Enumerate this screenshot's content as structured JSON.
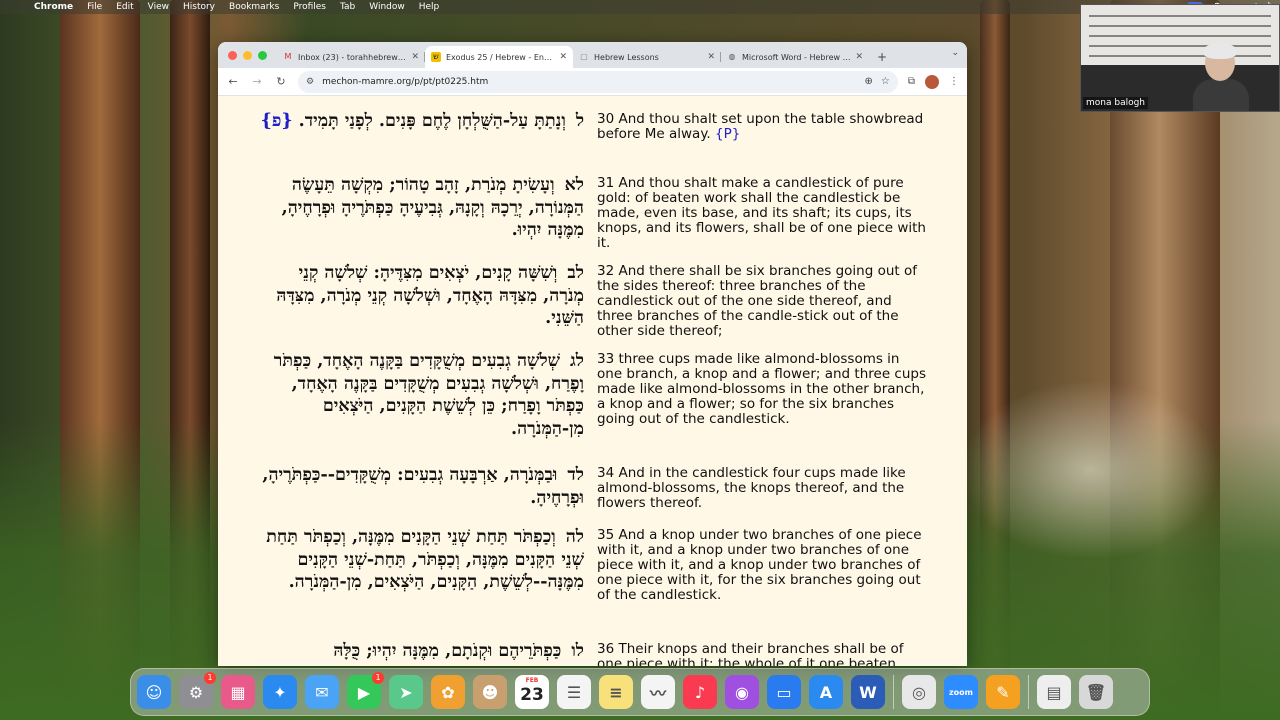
{
  "menubar": {
    "app_name": "Chrome",
    "items": [
      "File",
      "Edit",
      "View",
      "History",
      "Bookmarks",
      "Profiles",
      "Tab",
      "Window",
      "Help"
    ]
  },
  "zoom": {
    "participant_name": "mona balogh"
  },
  "browser": {
    "tabs": [
      {
        "title": "Inbox (23) - torahhebrewsch...",
        "icon": "gmail-icon",
        "active": false
      },
      {
        "title": "Exodus 25 / Hebrew - English",
        "icon": "mechon-mamre-icon",
        "active": true
      },
      {
        "title": "Hebrew Lessons",
        "icon": "doc-icon",
        "active": false
      },
      {
        "title": "Microsoft Word - Hebrew boo...",
        "icon": "globe-icon",
        "active": false
      }
    ],
    "new_tab_symbol": "+",
    "url": "mechon-mamre.org/p/pt/pt0225.htm"
  },
  "verses": [
    {
      "hebrew_num": "ל",
      "hebrew": "וְנָתַתָּ עַל-הַשֻּׁלְחָן לֶחֶם פָּנִים. לְפָנַי תָּמִיד.",
      "hebrew_p": "{פ}",
      "english": "30 And thou shalt set upon the table showbread before Me alway.",
      "english_p": "{P}"
    },
    {
      "hebrew_num": "לא",
      "hebrew": "וְעָשִׂיתָ מְנֹרַת, זָהָב טָהוֹר; מִקְשָׁה תֵּעָשֶׂה הַמְּנוֹרָה, יְרֵכָהּ וְקָנָהּ, גְּבִיעֶיהָ כַּפְתֹּרֶיהָ וּפְרָחֶיהָ, מִמֶּנָּה יִהְיוּ.",
      "english": "31 And thou shalt make a candlestick of pure gold: of beaten work shall the candlestick be made, even its base, and its shaft; its cups, its knops, and its flowers, shall be of one piece with it."
    },
    {
      "hebrew_num": "לב",
      "hebrew": "וְשִׁשָּׁה קָנִים, יֹצְאִים מִצִּדֶּיהָ: שְׁלֹשָׁה קְנֵי מְנֹרָה, מִצִּדָּהּ הָאֶחָד, וּשְׁלֹשָׁה קְנֵי מְנֹרָה, מִצִּדָּהּ הַשֵּׁנִי.",
      "english": "32 And there shall be six branches going out of the sides thereof: three branches of the candlestick out of the one side thereof, and three branches of the candle-stick out of the other side thereof;"
    },
    {
      "hebrew_num": "לג",
      "hebrew": "שְׁלֹשָׁה גְבִעִים מְשֻׁקָּדִים בַּקָּנֶה הָאֶחָד, כַּפְתֹּר וָפֶרַח, וּשְׁלֹשָׁה גְבִעִים מְשֻׁקָּדִים בַּקָּנֶה הָאֶחָד, כַּפְתֹּר וָפָרַח; כֵּן לְשֵׁשֶׁת הַקָּנִים, הַיֹּצְאִים מִן-הַמְּנֹרָה.",
      "english": "33 three cups made like almond-blossoms in one branch, a knop and a flower; and three cups made like almond-blossoms in the other branch, a knop and a flower; so for the six branches going out of the candlestick."
    },
    {
      "hebrew_num": "לד",
      "hebrew": "וּבַמְּנֹרָה, אַרְבָּעָה גְבִעִים: מְשֻׁקָּדִים--כַּפְתֹּרֶיהָ, וּפְרָחֶיהָ.",
      "english": "34 And in the candlestick four cups made like almond-blossoms, the knops thereof, and the flowers thereof."
    },
    {
      "hebrew_num": "לה",
      "hebrew": "וְכַפְתֹּר תַּחַת שְׁנֵי הַקָּנִים מִמֶּנָּה, וְכַפְתֹּר תַּחַת שְׁנֵי הַקָּנִים מִמֶּנָּה, וְכַפְתֹּר, תַּחַת-שְׁנֵי הַקָּנִים מִמֶּנָּה--לְשֵׁשֶׁת, הַקָּנִים, הַיֹּצְאִים, מִן-הַמְּנֹרָה.",
      "english": "35 And a knop under two branches of one piece with it, and a knop under two branches of one piece with it, and a knop under two branches of one piece with it, for the six branches going out of the candlestick."
    },
    {
      "hebrew_num": "לו",
      "hebrew": "כַּפְתֹּרֵיהֶם וּקְנֹתָם, מִמֶּנָּה יִהְיוּ; כֻּלָּהּ",
      "english": "36 Their knops and their branches shall be of one piece with it; the whole of it one beaten"
    }
  ],
  "dock": {
    "apps": [
      {
        "name": "finder-icon",
        "color": "#3a8ee8",
        "glyph": "☺"
      },
      {
        "name": "system-settings-icon",
        "color": "#8e8e93",
        "glyph": "⚙",
        "badge": "1"
      },
      {
        "name": "launchpad-icon",
        "color": "#e85a8a",
        "glyph": "▦"
      },
      {
        "name": "safari-icon",
        "color": "#2a8af0",
        "glyph": "✦"
      },
      {
        "name": "mail-icon",
        "color": "#4aa3f5",
        "glyph": "✉"
      },
      {
        "name": "facetime-icon",
        "color": "#34c759",
        "glyph": "▶",
        "badge": "1"
      },
      {
        "name": "maps-icon",
        "color": "#5ac88a",
        "glyph": "➤"
      },
      {
        "name": "photos-icon",
        "color": "#f0a030",
        "glyph": "✿"
      },
      {
        "name": "contacts-icon",
        "color": "#c8a070",
        "glyph": "☻"
      },
      {
        "name": "calendar-icon",
        "color": "#ffffff",
        "calendar_month": "FEB",
        "calendar_day": "23"
      },
      {
        "name": "reminders-icon",
        "color": "#f4f4f4",
        "glyph": "☰"
      },
      {
        "name": "notes-icon",
        "color": "#f8e17a",
        "glyph": "≡"
      },
      {
        "name": "freeform-icon",
        "color": "#f4f4f4",
        "glyph": "〰"
      },
      {
        "name": "music-icon",
        "color": "#fa3a50",
        "glyph": "♪"
      },
      {
        "name": "podcasts-icon",
        "color": "#a050e0",
        "glyph": "◉"
      },
      {
        "name": "keynote-icon",
        "color": "#2a7af0",
        "glyph": "▭"
      },
      {
        "name": "app-store-icon",
        "color": "#2a8af0",
        "glyph": "A"
      },
      {
        "name": "word-icon",
        "color": "#2b5cb8",
        "glyph": "W"
      },
      {
        "name": "chrome-icon",
        "color": "#e8e8e8",
        "glyph": "◎"
      },
      {
        "name": "zoom-icon",
        "color": "#2d8cff",
        "glyph": "zoom"
      },
      {
        "name": "pages-icon",
        "color": "#f5a020",
        "glyph": "✎"
      },
      {
        "name": "document-icon",
        "color": "#eeeeee",
        "glyph": "▤"
      },
      {
        "name": "trash-icon",
        "color": "#d8d8d8",
        "glyph": "🗑"
      }
    ]
  }
}
